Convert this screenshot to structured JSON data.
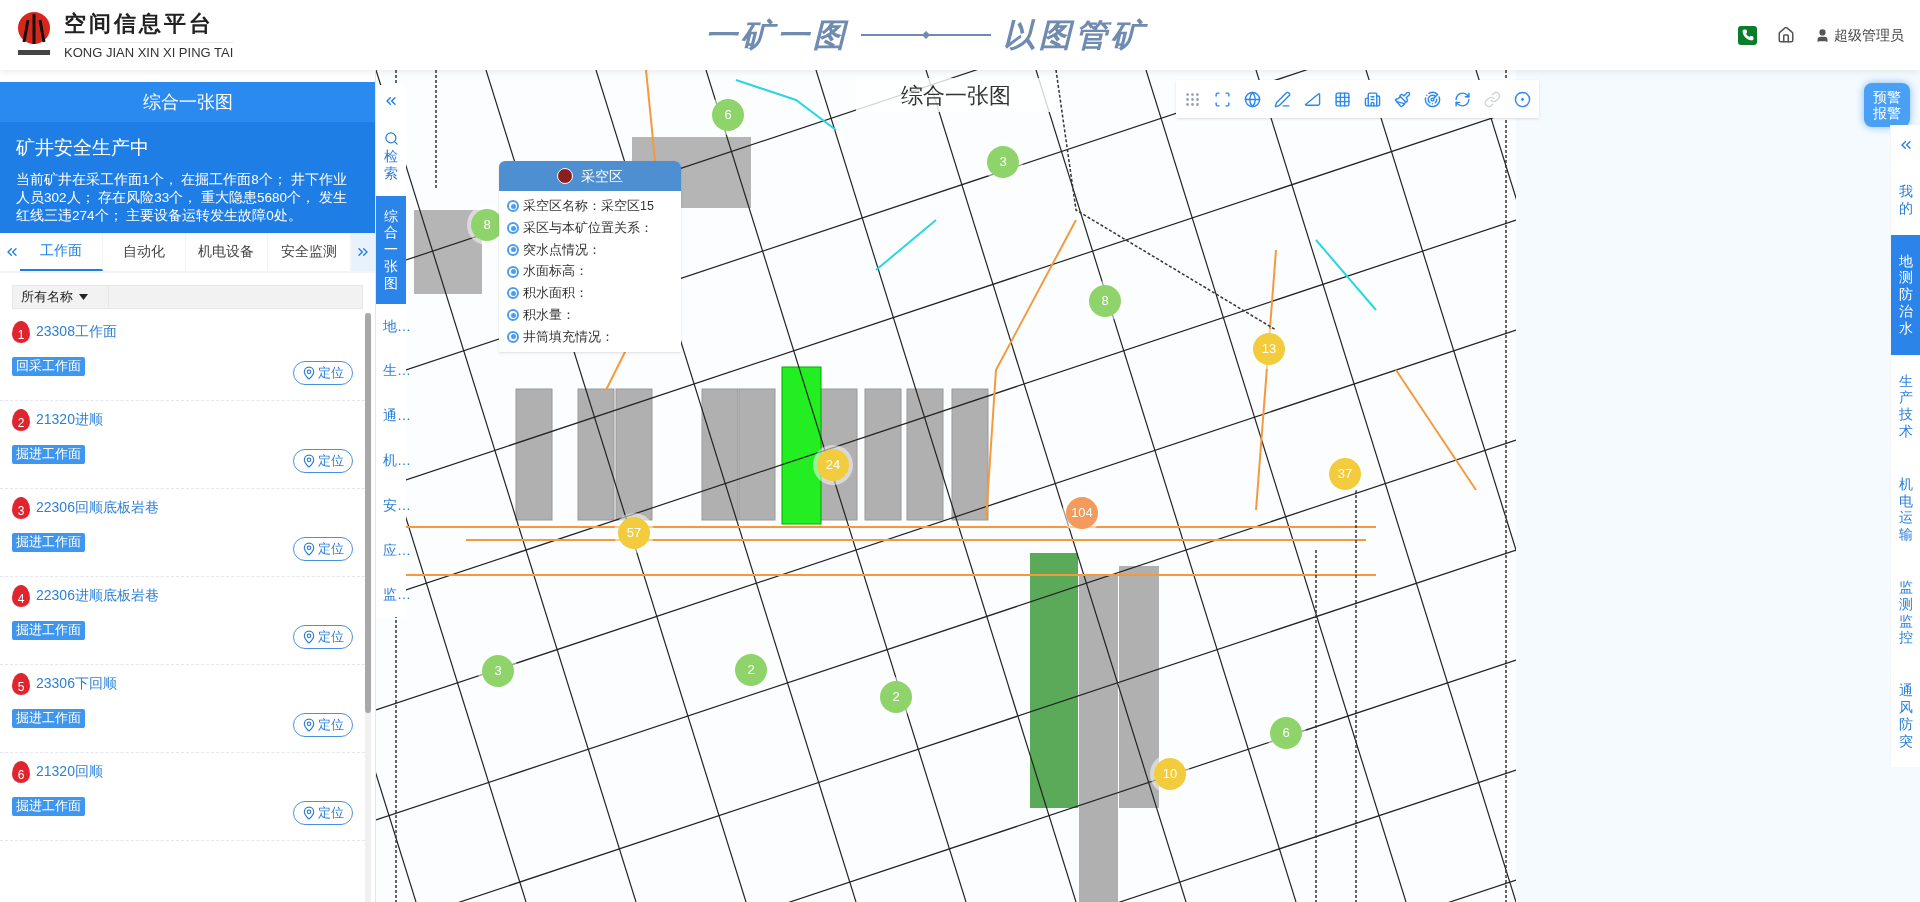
{
  "header": {
    "title": "空间信息平台",
    "subtitle": "KONG JIAN XIN XI PING TAI",
    "slogan_left": "一矿一图",
    "slogan_right": "以图管矿",
    "user": "超级管理员"
  },
  "left_panel": {
    "title": "综合一张图",
    "status_title": "矿井安全生产中",
    "summary": "当前矿井在采工作面1个， 在掘工作面8个； 井下作业人员302人； 存在风险33个， 重大隐患5680个， 发生红线三违274个； 主要设备运转发生故障0处。",
    "tabs": [
      {
        "label": "工作面",
        "selected": true
      },
      {
        "label": "自动化",
        "selected": false
      },
      {
        "label": "机电设备",
        "selected": false
      },
      {
        "label": "安全监测",
        "selected": false
      }
    ],
    "filter": {
      "label": "所有名称"
    },
    "items": [
      {
        "index": "1",
        "name": "23308工作面",
        "tag": "回采工作面",
        "locate": "定位"
      },
      {
        "index": "2",
        "name": "21320进顺",
        "tag": "掘进工作面",
        "locate": "定位"
      },
      {
        "index": "3",
        "name": "22306回顺底板岩巷",
        "tag": "掘进工作面",
        "locate": "定位"
      },
      {
        "index": "4",
        "name": "22306进顺底板岩巷",
        "tag": "掘进工作面",
        "locate": "定位"
      },
      {
        "index": "5",
        "name": "23306下回顺",
        "tag": "掘进工作面",
        "locate": "定位"
      },
      {
        "index": "6",
        "name": "21320回顺",
        "tag": "掘进工作面",
        "locate": "定位"
      }
    ]
  },
  "side_tabs": [
    {
      "kind": "search",
      "label": "检索",
      "selected": false
    },
    {
      "kind": "text",
      "label": "综合一张图",
      "selected": true
    },
    {
      "kind": "text",
      "label": "地…",
      "selected": false
    },
    {
      "kind": "text",
      "label": "生…",
      "selected": false
    },
    {
      "kind": "text",
      "label": "通…",
      "selected": false
    },
    {
      "kind": "text",
      "label": "机…",
      "selected": false
    },
    {
      "kind": "text",
      "label": "安…",
      "selected": false
    },
    {
      "kind": "text",
      "label": "应…",
      "selected": false
    },
    {
      "kind": "text",
      "label": "监…",
      "selected": false
    }
  ],
  "map": {
    "title": "综合一张图",
    "popup": {
      "title": "采空区",
      "fields": [
        "采空区名称：采空区15",
        "采区与本矿位置关系：",
        "突水点情况：",
        "水面标高：",
        "积水面积：",
        "积水量：",
        "井筒填充情况："
      ]
    },
    "clusters": [
      {
        "label": "6",
        "color": "#8fd46a"
      },
      {
        "label": "3",
        "color": "#8fd46a"
      },
      {
        "label": "8",
        "color": "#8fd46a"
      },
      {
        "label": "8",
        "color": "#8fd46a"
      },
      {
        "label": "13",
        "color": "#f2cc3c"
      },
      {
        "label": "24",
        "color": "#f2cc3c"
      },
      {
        "label": "37",
        "color": "#f2cc3c"
      },
      {
        "label": "104",
        "color": "#f39a5c"
      },
      {
        "label": "57",
        "color": "#f2cc3c"
      },
      {
        "label": "3",
        "color": "#8fd46a"
      },
      {
        "label": "2",
        "color": "#8fd46a"
      },
      {
        "label": "2",
        "color": "#8fd46a"
      },
      {
        "label": "6",
        "color": "#8fd46a"
      },
      {
        "label": "10",
        "color": "#f2cc3c"
      }
    ]
  },
  "alert_button": "预警报警",
  "right_tabs": [
    {
      "label": "我的",
      "selected": false
    },
    {
      "label": "地测防治水",
      "selected": true
    },
    {
      "label": "生产技术",
      "selected": false
    },
    {
      "label": "机电运输",
      "selected": false
    },
    {
      "label": "监测监控",
      "selected": false
    },
    {
      "label": "通风防突",
      "selected": false
    }
  ]
}
